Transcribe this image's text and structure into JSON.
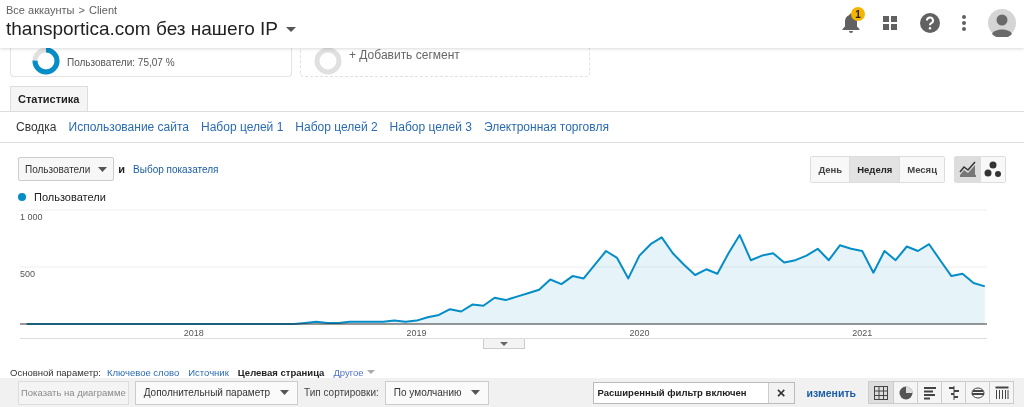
{
  "header": {
    "breadcrumb": [
      {
        "label": "Все аккаунты"
      },
      {
        "label": "Client"
      }
    ],
    "separator": ">",
    "title": "thansportica.com без нашего IP",
    "notifications": {
      "badge": "1"
    }
  },
  "segments": [
    {
      "kind": "segment",
      "label": "Пользователи: 75,07 %",
      "level": 0.7507
    },
    {
      "kind": "add",
      "label": "+ Добавить сегмент"
    }
  ],
  "report_tabs": [
    {
      "label": "Статистика",
      "selected": true
    }
  ],
  "sub_tabs": [
    {
      "label": "Сводка",
      "selected": true
    },
    {
      "label": "Использование сайта",
      "selected": false
    },
    {
      "label": "Набор целей 1",
      "selected": false
    },
    {
      "label": "Набор целей 2",
      "selected": false
    },
    {
      "label": "Набор целей 3",
      "selected": false
    },
    {
      "label": "Электронная торговля",
      "selected": false
    }
  ],
  "metric_controls": {
    "metric": "Пользователи",
    "conjunction": "и",
    "choose_metric": "Выбор показателя"
  },
  "period_buttons": [
    {
      "label": "День",
      "selected": false
    },
    {
      "label": "Неделя",
      "selected": true
    },
    {
      "label": "Месяц",
      "selected": false
    }
  ],
  "chart_type_buttons": [
    {
      "kind": "line",
      "selected": true
    },
    {
      "kind": "motion",
      "selected": false
    }
  ],
  "chart": {
    "chart_data": {
      "type": "area",
      "xlim": [
        2017.22,
        2021.56
      ],
      "ylim": [
        0,
        1000
      ],
      "yticks": [
        {
          "value": 500,
          "label": "500"
        },
        {
          "value": 1000,
          "label": "1 000"
        }
      ],
      "xticks": [
        2018,
        2019,
        2020,
        2021
      ],
      "x": [
        2017.25,
        2017.3,
        2017.35,
        2017.4,
        2017.45,
        2017.5,
        2017.55,
        2017.6,
        2017.65,
        2017.7,
        2017.75,
        2017.8,
        2017.85,
        2017.9,
        2017.95,
        2018.0,
        2018.05,
        2018.1,
        2018.15,
        2018.2,
        2018.25,
        2018.3,
        2018.35,
        2018.4,
        2018.45,
        2018.5,
        2018.55,
        2018.6,
        2018.65,
        2018.7,
        2018.75,
        2018.8,
        2018.85,
        2018.9,
        2018.95,
        2019.0,
        2019.05,
        2019.1,
        2019.15,
        2019.2,
        2019.25,
        2019.3,
        2019.35,
        2019.4,
        2019.45,
        2019.5,
        2019.55,
        2019.6,
        2019.65,
        2019.7,
        2019.75,
        2019.8,
        2019.85,
        2019.9,
        2019.95,
        2020.0,
        2020.05,
        2020.1,
        2020.15,
        2020.2,
        2020.25,
        2020.3,
        2020.35,
        2020.4,
        2020.45,
        2020.5,
        2020.55,
        2020.6,
        2020.65,
        2020.7,
        2020.75,
        2020.8,
        2020.85,
        2020.9,
        2020.95,
        2021.0,
        2021.05,
        2021.1,
        2021.15,
        2021.2,
        2021.25,
        2021.3,
        2021.35,
        2021.4,
        2021.45,
        2021.5,
        2021.55
      ],
      "series": [
        {
          "name": "Пользователи",
          "color": "#058dc7",
          "values": [
            0,
            0,
            0,
            0,
            0,
            0,
            0,
            0,
            0,
            0,
            0,
            0,
            0,
            0,
            0,
            0,
            0,
            0,
            0,
            0,
            0,
            0,
            0,
            0,
            0,
            10,
            20,
            10,
            10,
            20,
            20,
            20,
            20,
            30,
            20,
            30,
            60,
            80,
            130,
            110,
            170,
            160,
            230,
            210,
            240,
            270,
            300,
            390,
            350,
            420,
            400,
            520,
            640,
            580,
            400,
            600,
            700,
            760,
            620,
            520,
            430,
            480,
            440,
            620,
            780,
            560,
            600,
            620,
            540,
            560,
            600,
            660,
            560,
            690,
            660,
            640,
            450,
            640,
            560,
            680,
            640,
            700,
            560,
            420,
            440,
            360,
            330
          ]
        }
      ]
    }
  },
  "primary_dimension": {
    "label": "Основной параметр:",
    "options": [
      {
        "label": "Ключевое слово",
        "selected": false
      },
      {
        "label": "Источник",
        "selected": false
      },
      {
        "label": "Целевая страница",
        "selected": true
      }
    ],
    "more": "Другое"
  },
  "table_toolbar": {
    "plot_button": {
      "label": "Показать на диаграмме",
      "disabled": true
    },
    "secondary_dimension": "Дополнительный параметр",
    "sort_label": "Тип сортировки:",
    "sort_value": "По умолчанию",
    "filter_value": "Расширенный фильтр включен",
    "clear": "×",
    "edit_link": "изменить",
    "views": [
      {
        "kind": "table",
        "selected": true
      },
      {
        "kind": "pie",
        "selected": false
      },
      {
        "kind": "bars",
        "selected": false
      },
      {
        "kind": "comparison",
        "selected": false
      },
      {
        "kind": "terms",
        "selected": false
      },
      {
        "kind": "pivot",
        "selected": false
      }
    ]
  }
}
